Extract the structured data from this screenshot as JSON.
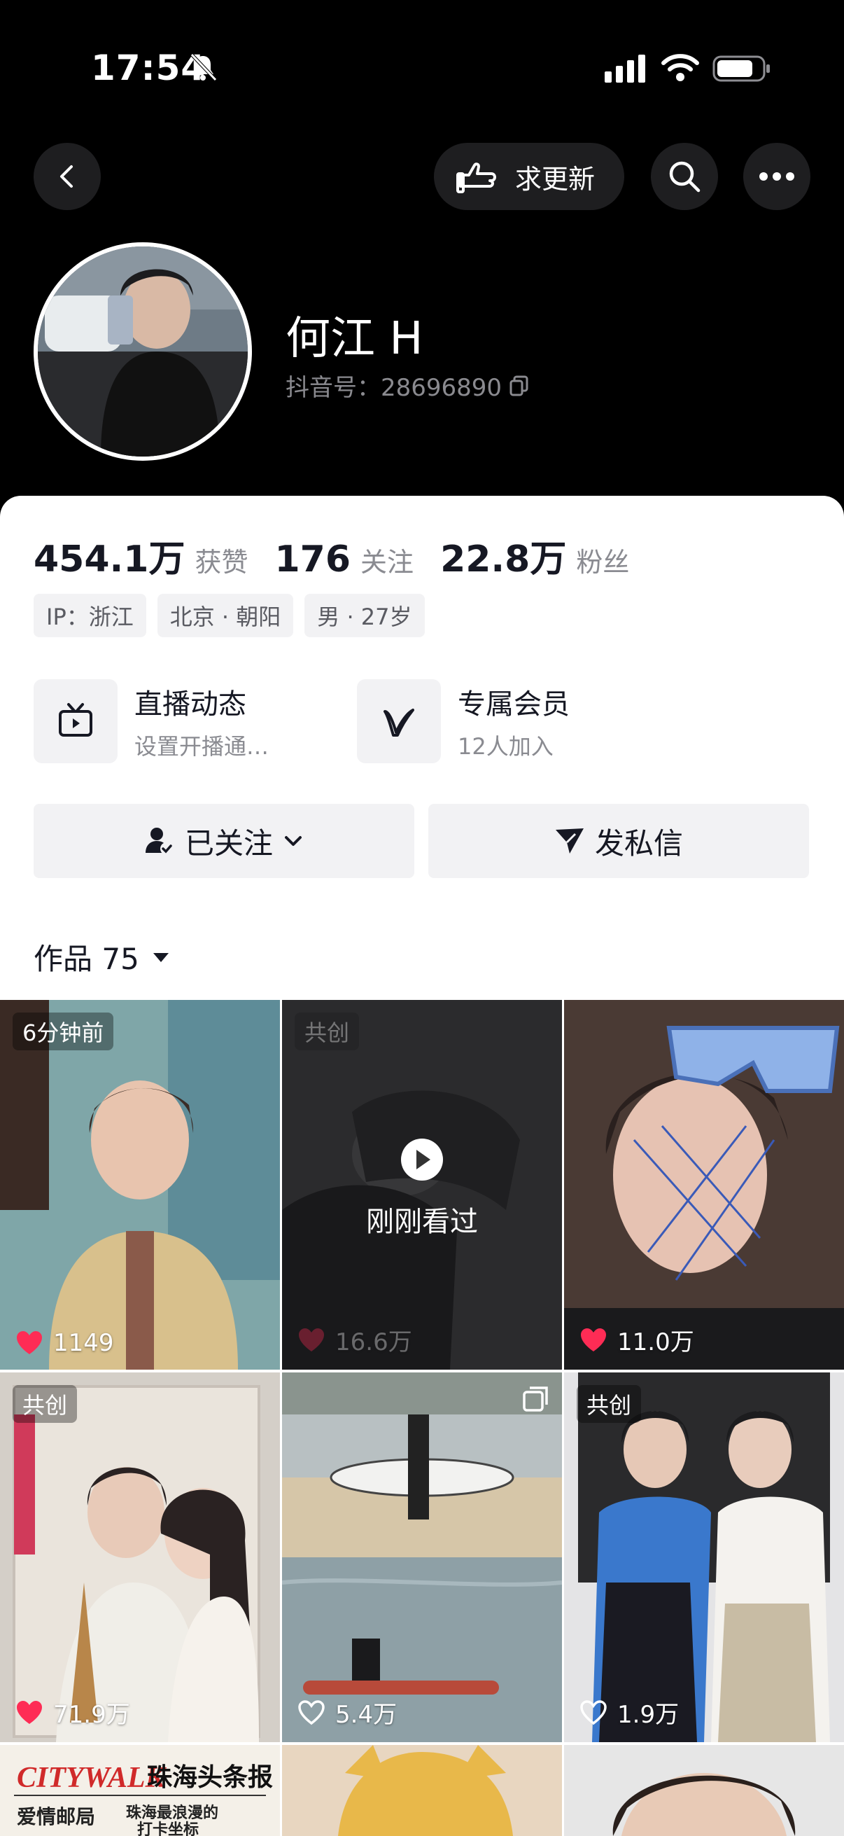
{
  "status_bar": {
    "time": "17:54"
  },
  "header": {
    "update_label": "求更新"
  },
  "profile": {
    "name": "何江 H",
    "douyin_id": "抖音号：28696890",
    "stats": [
      {
        "value": "454.1万",
        "label": "获赞"
      },
      {
        "value": "176",
        "label": "关注"
      },
      {
        "value": "22.8万",
        "label": "粉丝"
      }
    ],
    "tags": [
      "IP：浙江",
      "北京 · 朝阳",
      "男 · 27岁"
    ],
    "features": [
      {
        "title": "直播动态",
        "subtitle": "设置开播通…"
      },
      {
        "title": "专属会员",
        "subtitle": "12人加入"
      }
    ],
    "follow_label": "已关注",
    "message_label": "发私信",
    "works_label": "作品 75"
  },
  "grid": [
    {
      "badge": "6分钟前",
      "likes": "1149",
      "liked": true
    },
    {
      "badge": "共创",
      "likes": "16.6万",
      "overlay": "刚刚看过",
      "liked": true
    },
    {
      "badge": "",
      "likes": "11.0万",
      "liked": true
    },
    {
      "badge": "共创",
      "likes": "71.9万",
      "liked": true
    },
    {
      "badge": "",
      "likes": "5.4万",
      "liked": false
    },
    {
      "badge": "共创",
      "likes": "1.9万",
      "liked": false
    },
    {
      "badge": "",
      "likes": "",
      "liked": false
    },
    {
      "badge": "",
      "likes": "",
      "liked": false
    },
    {
      "badge": "",
      "likes": "",
      "liked": false
    }
  ],
  "partial_tile_text": {
    "brand": "CITYWALK",
    "headline": "珠海头条报",
    "sub1": "爱情邮局",
    "sub2": "珠海最浪漫的",
    "sub3": "打卡坐标"
  },
  "colors": {
    "accent": "#fe2c55",
    "sheet_bg": "#ffffff",
    "dark_bg": "#000000"
  }
}
